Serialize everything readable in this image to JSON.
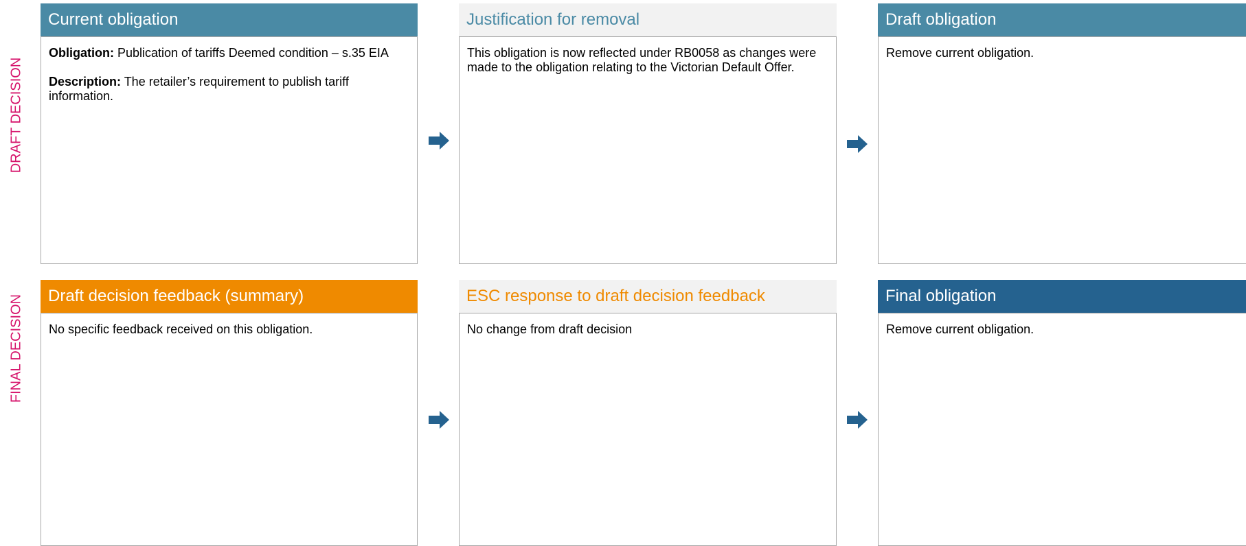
{
  "rows": {
    "draft": {
      "label": "DRAFT DECISION",
      "current": {
        "title": "Current obligation",
        "obligation_label": "Obligation:",
        "obligation_text": " Publication of tariffs Deemed condition – s.35 EIA",
        "description_label": "Description:",
        "description_text": " The retailer’s requirement to publish tariff information."
      },
      "justification": {
        "title": "Justification for removal",
        "text": "This obligation is now reflected under RB0058 as changes were made to the obligation relating to the Victorian Default Offer."
      },
      "draft_obligation": {
        "title": "Draft obligation",
        "text": "Remove current obligation."
      }
    },
    "final": {
      "label": "FINAL DECISION",
      "feedback": {
        "title": "Draft decision feedback (summary)",
        "text": "No specific feedback received on this obligation."
      },
      "response": {
        "title": "ESC response to draft decision feedback",
        "text": "No change from draft decision"
      },
      "final_obligation": {
        "title": "Final obligation",
        "text": "Remove current obligation."
      }
    }
  },
  "colors": {
    "teal": "#4a8aa5",
    "orange": "#ef8a00",
    "navy": "#25628f",
    "magenta": "#d6136b",
    "arrow": "#25628f"
  },
  "icons": {
    "arrow": "right-arrow-icon"
  }
}
